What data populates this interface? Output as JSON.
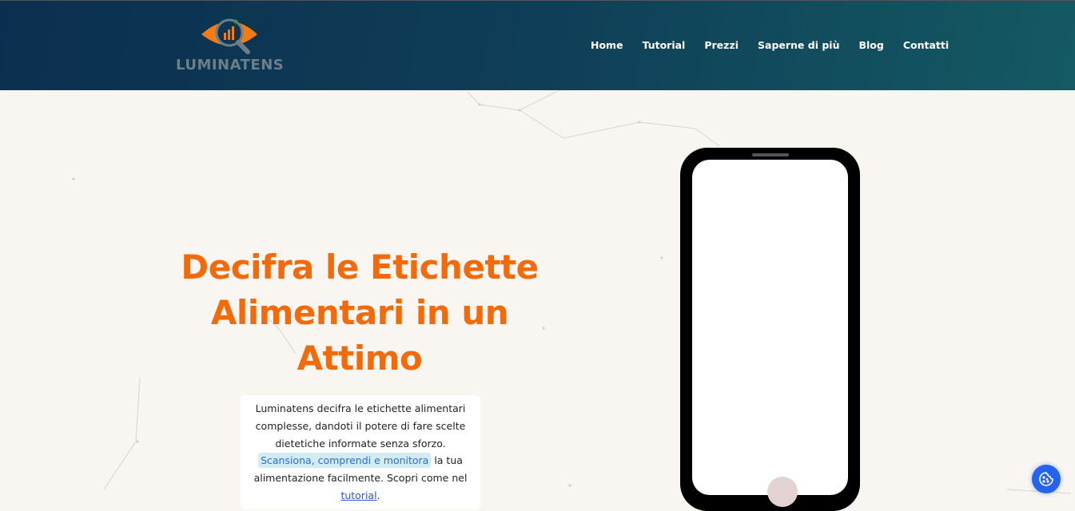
{
  "brand": {
    "name": "LUMINATENS"
  },
  "nav": [
    "Home",
    "Tutorial",
    "Prezzi",
    "Saperne di più",
    "Blog",
    "Contatti"
  ],
  "hero": {
    "title": "Decifra le Etichette Alimentari in un Attimo",
    "desc_1": "Luminatens decifra le etichette alimentari complesse, dandoti il potere di fare scelte dietetiche informate senza sforzo.",
    "highlight": "Scansiona, comprendi e monitora",
    "desc_2": " la tua alimentazione facilmente. Scopri come nel ",
    "link": "tutorial",
    "desc_3": "."
  },
  "colors": {
    "accent": "#f26a0a",
    "header": "#0b2f50",
    "cookie": "#2563eb"
  },
  "icons": {
    "cookie": "cookie-icon"
  }
}
